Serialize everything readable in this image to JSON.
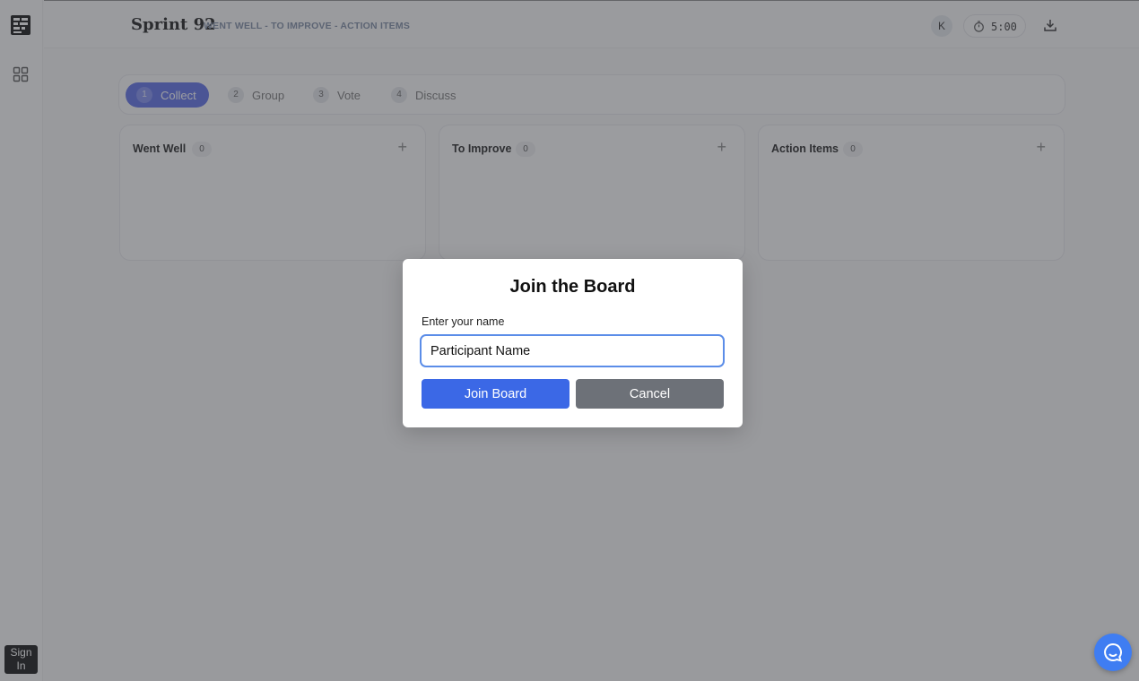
{
  "sidebar": {
    "sign_in_label": "Sign In"
  },
  "header": {
    "title": "Sprint 92",
    "subtitle": "WENT WELL - TO IMPROVE - ACTION ITEMS",
    "avatar_initial": "K",
    "timer": "5:00"
  },
  "phases": [
    {
      "number": "1",
      "label": "Collect",
      "active": true
    },
    {
      "number": "2",
      "label": "Group"
    },
    {
      "number": "3",
      "label": "Vote"
    },
    {
      "number": "4",
      "label": "Discuss"
    }
  ],
  "columns": [
    {
      "title": "Went Well",
      "count": "0"
    },
    {
      "title": "To Improve",
      "count": "0"
    },
    {
      "title": "Action Items",
      "count": "0"
    }
  ],
  "add_symbol": "+",
  "modal": {
    "title": "Join the Board",
    "label": "Enter your name",
    "input_value": "Participant Name",
    "join_label": "Join Board",
    "cancel_label": "Cancel"
  },
  "icons": {
    "logo": "grid-logo-icon",
    "nav": "dashboard-icon",
    "timer": "stopwatch-icon",
    "download": "download-icon",
    "chat": "chat-bubble-icon"
  },
  "colors": {
    "accent": "#5b6ce6",
    "join_button": "#3b68e6",
    "cancel_button": "#6d7178",
    "chat": "#3f7df2"
  }
}
